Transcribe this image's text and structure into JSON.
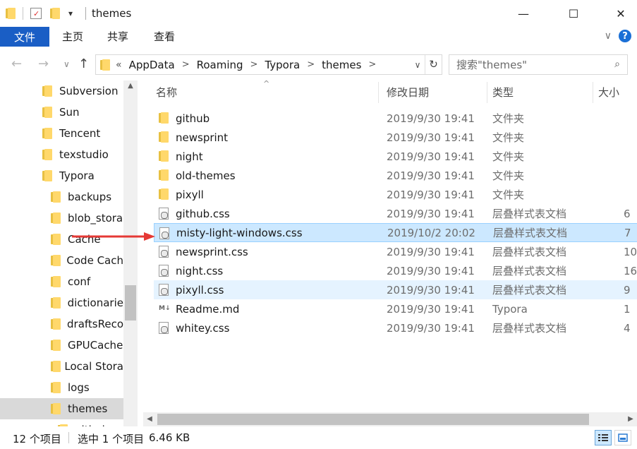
{
  "window": {
    "title": "themes",
    "qat_dropdown": "▾",
    "minimize": "—",
    "maximize": "☐",
    "close": "✕"
  },
  "ribbon": {
    "file": "文件",
    "tabs": [
      "主页",
      "共享",
      "查看"
    ],
    "collapse": "∨",
    "help": "?"
  },
  "nav": {
    "back": "←",
    "forward": "→",
    "recent": "∨",
    "up": "↑",
    "breadcrumb_overflow": "«",
    "breadcrumb": [
      "AppData",
      "Roaming",
      "Typora",
      "themes"
    ],
    "crumb_sep": ">",
    "dropdown": "∨",
    "refresh": "↻",
    "search_placeholder": "搜索\"themes\"",
    "search_icon": "⌕"
  },
  "tree": [
    {
      "label": "Subversion",
      "selected": false
    },
    {
      "label": "Sun",
      "selected": false
    },
    {
      "label": "Tencent",
      "selected": false
    },
    {
      "label": "texstudio",
      "selected": false
    },
    {
      "label": "Typora",
      "selected": false
    },
    {
      "label": "backups",
      "selected": false
    },
    {
      "label": "blob_stora",
      "selected": false
    },
    {
      "label": "Cache",
      "selected": false
    },
    {
      "label": "Code Cach",
      "selected": false
    },
    {
      "label": "conf",
      "selected": false
    },
    {
      "label": "dictionarie",
      "selected": false
    },
    {
      "label": "draftsReco",
      "selected": false
    },
    {
      "label": "GPUCache",
      "selected": false
    },
    {
      "label": "Local Stora",
      "selected": false
    },
    {
      "label": "logs",
      "selected": false
    },
    {
      "label": "themes",
      "selected": true
    },
    {
      "label": "githuk",
      "selected": false
    }
  ],
  "columns": {
    "name": "名称",
    "date": "修改日期",
    "type": "类型",
    "size": "大小"
  },
  "files": [
    {
      "name": "github",
      "date": "2019/9/30 19:41",
      "type": "文件夹",
      "size": "",
      "icon": "folder"
    },
    {
      "name": "newsprint",
      "date": "2019/9/30 19:41",
      "type": "文件夹",
      "size": "",
      "icon": "folder"
    },
    {
      "name": "night",
      "date": "2019/9/30 19:41",
      "type": "文件夹",
      "size": "",
      "icon": "folder"
    },
    {
      "name": "old-themes",
      "date": "2019/9/30 19:41",
      "type": "文件夹",
      "size": "",
      "icon": "folder"
    },
    {
      "name": "pixyll",
      "date": "2019/9/30 19:41",
      "type": "文件夹",
      "size": "",
      "icon": "folder"
    },
    {
      "name": "github.css",
      "date": "2019/9/30 19:41",
      "type": "层叠样式表文档",
      "size": "6",
      "icon": "css"
    },
    {
      "name": "misty-light-windows.css",
      "date": "2019/10/2 20:02",
      "type": "层叠样式表文档",
      "size": "7",
      "icon": "css"
    },
    {
      "name": "newsprint.css",
      "date": "2019/9/30 19:41",
      "type": "层叠样式表文档",
      "size": "10",
      "icon": "css"
    },
    {
      "name": "night.css",
      "date": "2019/9/30 19:41",
      "type": "层叠样式表文档",
      "size": "16",
      "icon": "css"
    },
    {
      "name": "pixyll.css",
      "date": "2019/9/30 19:41",
      "type": "层叠样式表文档",
      "size": "9",
      "icon": "css"
    },
    {
      "name": "Readme.md",
      "date": "2019/9/30 19:41",
      "type": "Typora",
      "size": "1",
      "icon": "md"
    },
    {
      "name": "whitey.css",
      "date": "2019/9/30 19:41",
      "type": "层叠样式表文档",
      "size": "4",
      "icon": "css"
    }
  ],
  "status": {
    "count": "12 个项目",
    "selection": "选中 1 个项目",
    "selection_size": "6.46 KB"
  },
  "colors": {
    "accent": "#1a5ec5",
    "selection": "#cce8ff",
    "hover": "#e5f3ff",
    "annotation_arrow": "#e53935"
  }
}
